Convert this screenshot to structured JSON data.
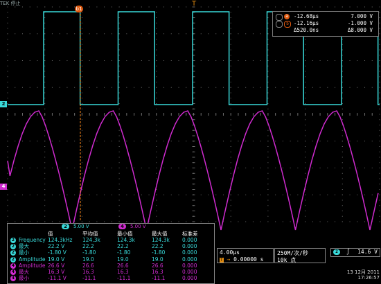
{
  "scope": {
    "top_mark": "TEK 停止",
    "trigger_marker_top": "b1",
    "trigger_pos_marker": "T",
    "channels": {
      "ch2": {
        "label": "2",
        "color": "#39d9d9",
        "scale": "5.00 V"
      },
      "ch4": {
        "label": "4",
        "color": "#d02bd0",
        "scale": "5.00 V"
      }
    }
  },
  "cursors": {
    "row_a": {
      "tag": "a",
      "time": "-12.68μs",
      "volt": "7.000 V"
    },
    "row_b": {
      "tag": "b",
      "time": "-12.16μs",
      "volt": "-1.000 V"
    },
    "row_delta": {
      "time": "Δ520.0ns",
      "volt": "Δ8.000 V"
    }
  },
  "measurements": {
    "headers": [
      "值",
      "平均值",
      "最小值",
      "最大值",
      "标准差"
    ],
    "rows": [
      {
        "ch": "2",
        "name": "Frequency",
        "value": "124.3kHz",
        "mean": "124.3k",
        "min": "124.3k",
        "max": "124.3k",
        "std": "0.000"
      },
      {
        "ch": "2",
        "name": "最大",
        "value": "22.2 V",
        "mean": "22.2",
        "min": "22.2",
        "max": "22.2",
        "std": "0.000"
      },
      {
        "ch": "2",
        "name": "最小",
        "value": "-1.80 V",
        "mean": "-1.80",
        "min": "-1.80",
        "max": "-1.80",
        "std": "0.000"
      },
      {
        "ch": "2",
        "name": "Amplitude",
        "value": "19.0 V",
        "mean": "19.0",
        "min": "19.0",
        "max": "19.0",
        "std": "0.000"
      },
      {
        "ch": "4",
        "name": "Amplitude",
        "value": "26.6 V",
        "mean": "26.6",
        "min": "26.6",
        "max": "26.6",
        "std": "0.000"
      },
      {
        "ch": "4",
        "name": "最大",
        "value": "16.3 V",
        "mean": "16.3",
        "min": "16.3",
        "max": "16.3",
        "std": "0.000"
      },
      {
        "ch": "4",
        "name": "最小",
        "value": "-11.1 V",
        "mean": "-11.1",
        "min": "-11.1",
        "max": "-11.1",
        "std": "0.000"
      }
    ]
  },
  "horizontal": {
    "timebase": "4.00μs",
    "delay": "0.00000 s",
    "delay_tag": "T"
  },
  "acquisition": {
    "rate": "250M/次/秒",
    "record": "10k 点"
  },
  "trigger": {
    "ch": "2",
    "slope": "∫",
    "level": "14.6 V"
  },
  "datetime": {
    "date": "13 12月 2011",
    "time": "17:26:57"
  }
}
